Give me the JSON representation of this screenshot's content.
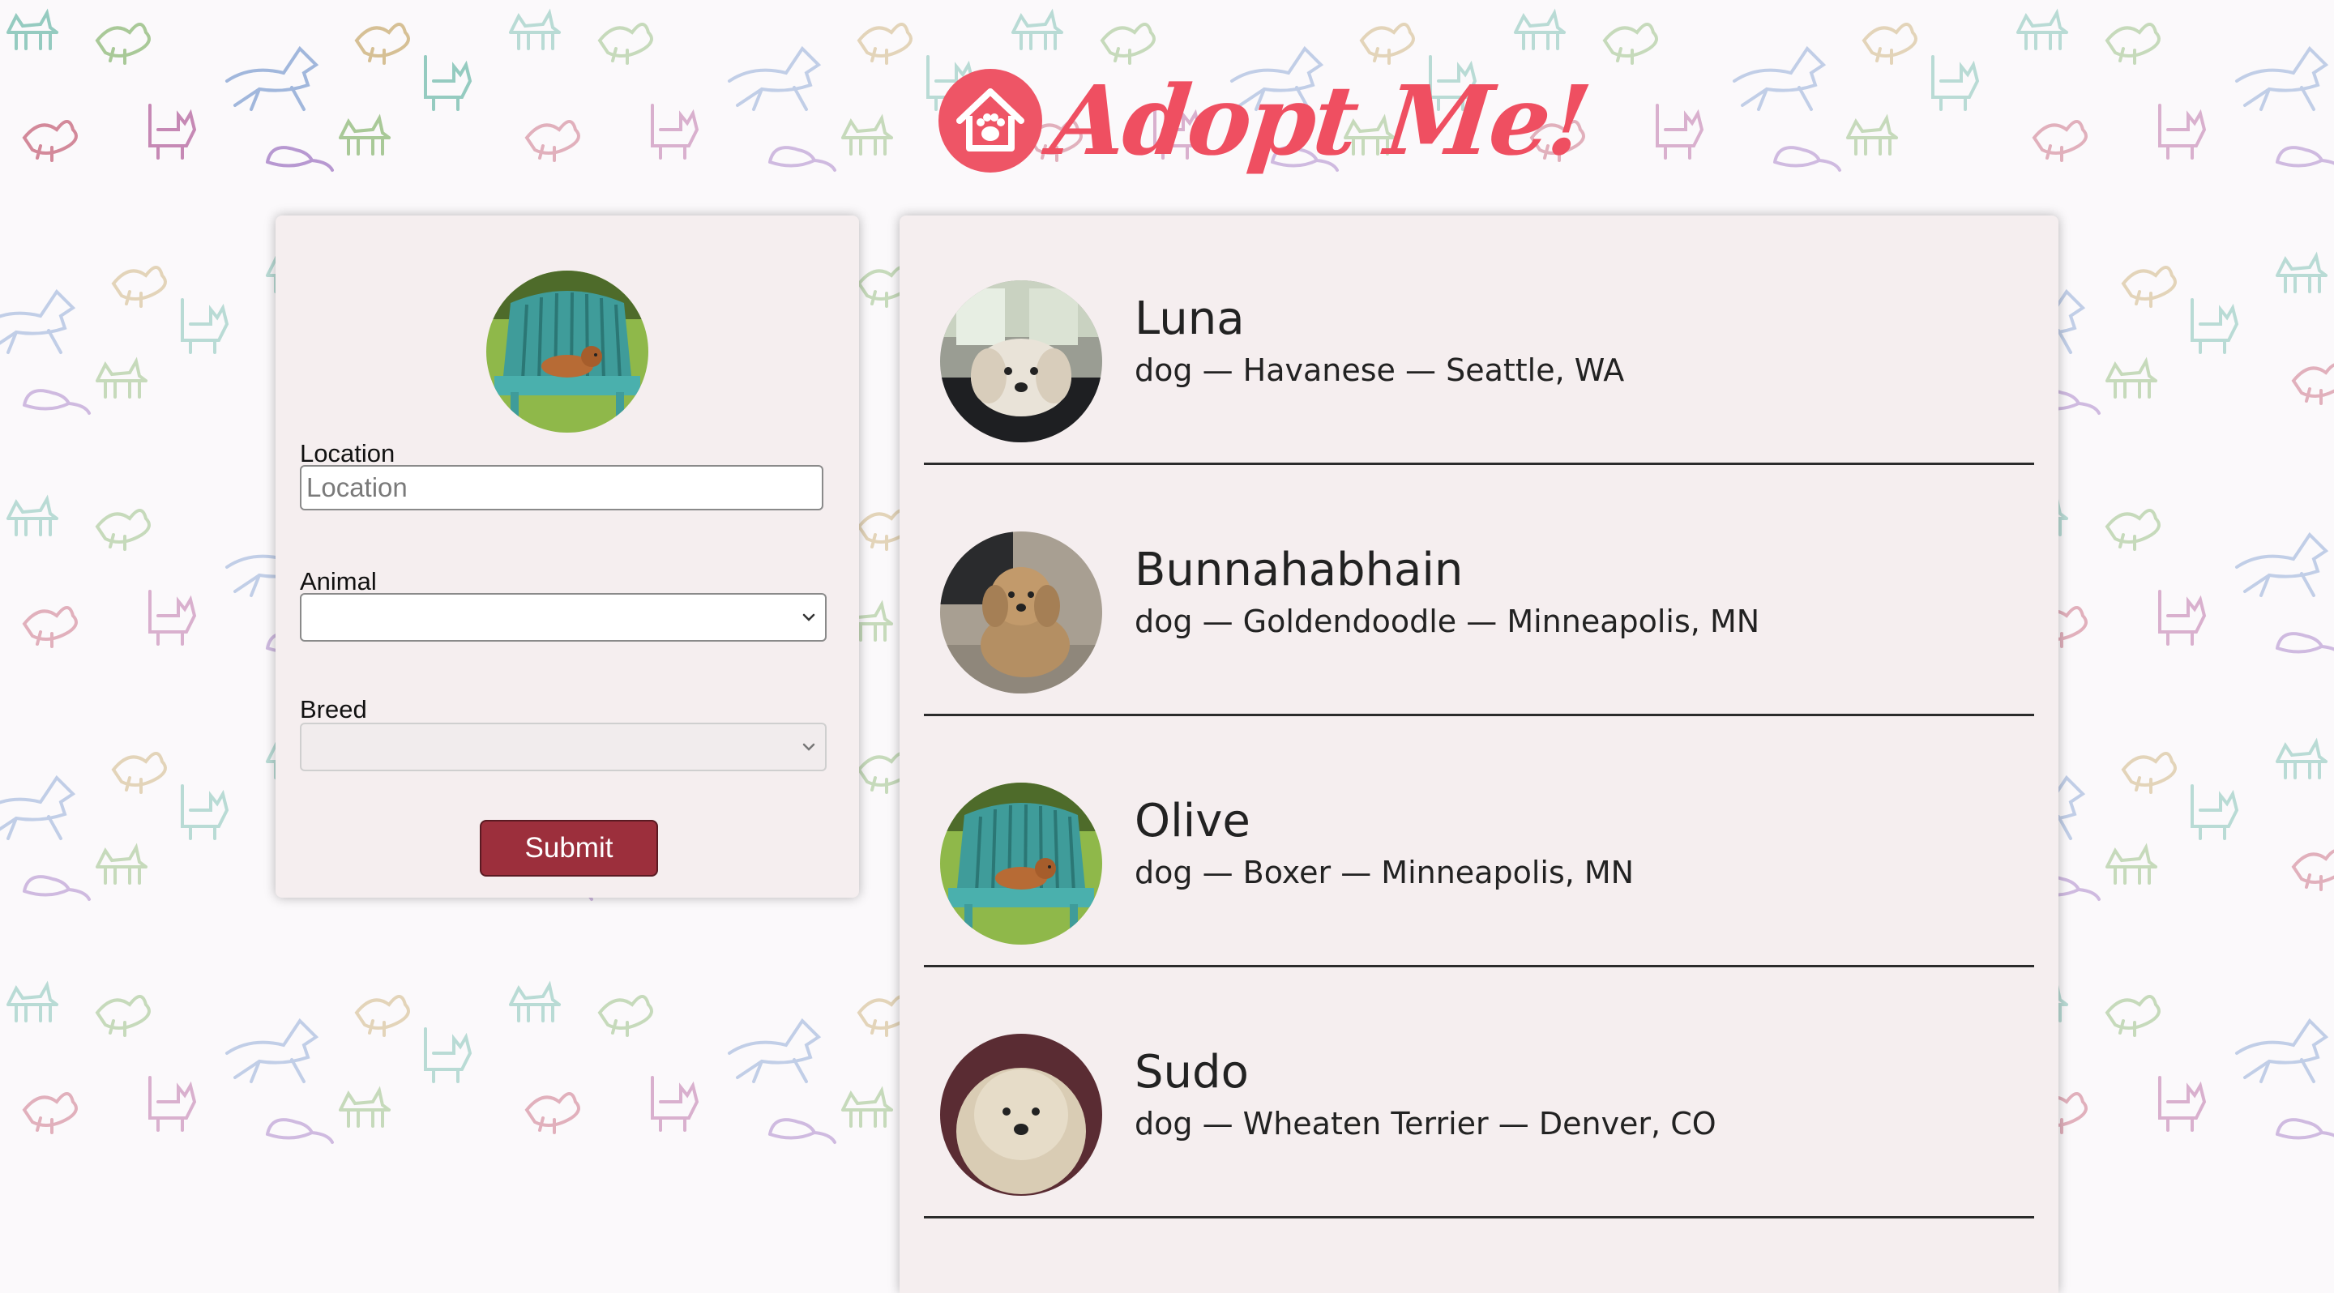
{
  "app": {
    "logo_text": "Adopt Me!",
    "accent_color": "#ef4f61",
    "logo_icon": "house-paw-icon"
  },
  "search": {
    "location_label": "Location",
    "location_placeholder": "Location",
    "location_value": "",
    "animal_label": "Animal",
    "animal_value": "",
    "breed_label": "Breed",
    "breed_value": "",
    "breed_disabled": true,
    "submit_label": "Submit",
    "submit_color": "#9c2f3c"
  },
  "pets": [
    {
      "name": "Luna",
      "info": "dog — Havanese — Seattle, WA"
    },
    {
      "name": "Bunnahabhain",
      "info": "dog — Goldendoodle — Minneapolis, MN"
    },
    {
      "name": "Olive",
      "info": "dog — Boxer — Minneapolis, MN"
    },
    {
      "name": "Sudo",
      "info": "dog — Wheaten Terrier — Denver, CO"
    }
  ]
}
